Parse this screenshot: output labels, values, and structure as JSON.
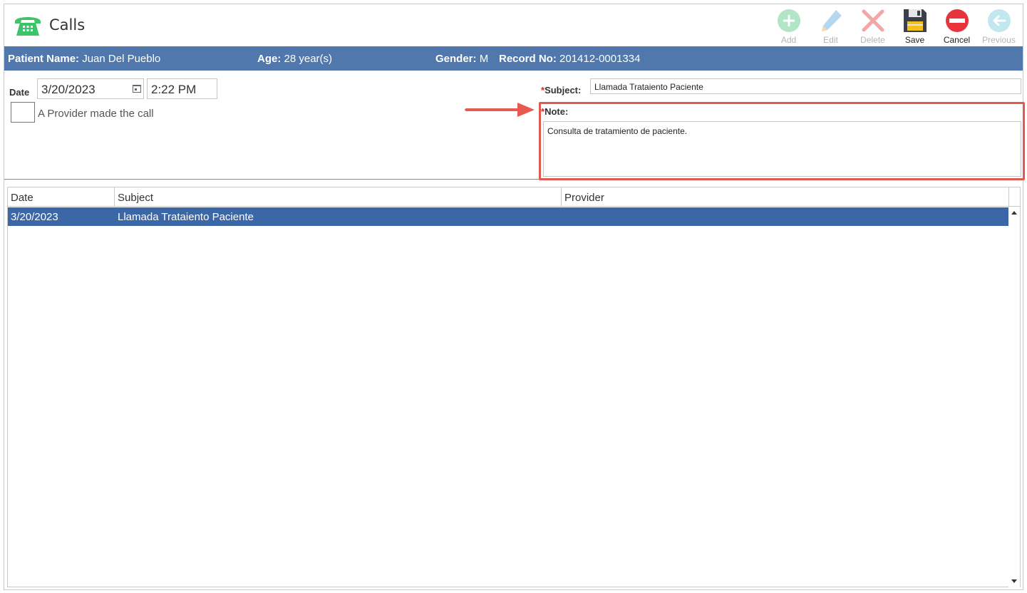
{
  "header": {
    "title": "Calls"
  },
  "toolbar": {
    "add": "Add",
    "edit": "Edit",
    "delete": "Delete",
    "save": "Save",
    "cancel": "Cancel",
    "previous": "Previous"
  },
  "patient": {
    "name_label": "Patient Name:",
    "name": "Juan Del Pueblo",
    "age_label": "Age:",
    "age": "28 year(s)",
    "gender_label": "Gender:",
    "gender": "M",
    "record_label": "Record No:",
    "record": "201412-0001334"
  },
  "form": {
    "date_label": "Date",
    "date": "3/20/2023",
    "time": "2:22 PM",
    "provider_checkbox_label": "A Provider made the call",
    "provider_checked": false,
    "subject_label": "Subject:",
    "subject": "Llamada Trataiento Paciente",
    "note_label": "Note:",
    "note": "Consulta de tratamiento de paciente.",
    "required_mark": "*"
  },
  "grid": {
    "columns": [
      "Date",
      "Subject",
      "Provider"
    ],
    "rows": [
      {
        "date": "3/20/2023",
        "subject": "Llamada Trataiento Paciente",
        "provider": ""
      }
    ]
  },
  "colors": {
    "patient_bar": "#5078ad",
    "selected_row": "#3b67a6",
    "highlight": "#e05a50",
    "add_icon": "#7ed3a0",
    "edit_icon": "#9cc9ec",
    "delete_icon": "#f4a6a6",
    "cancel_icon": "#e8323c",
    "previous_icon": "#a7dde8"
  },
  "icons": {
    "app": "phone-icon",
    "add": "plus-circle-icon",
    "edit": "pencil-icon",
    "delete": "x-icon",
    "save": "floppy-disk-icon",
    "cancel": "no-entry-icon",
    "previous": "arrow-left-circle-icon"
  }
}
